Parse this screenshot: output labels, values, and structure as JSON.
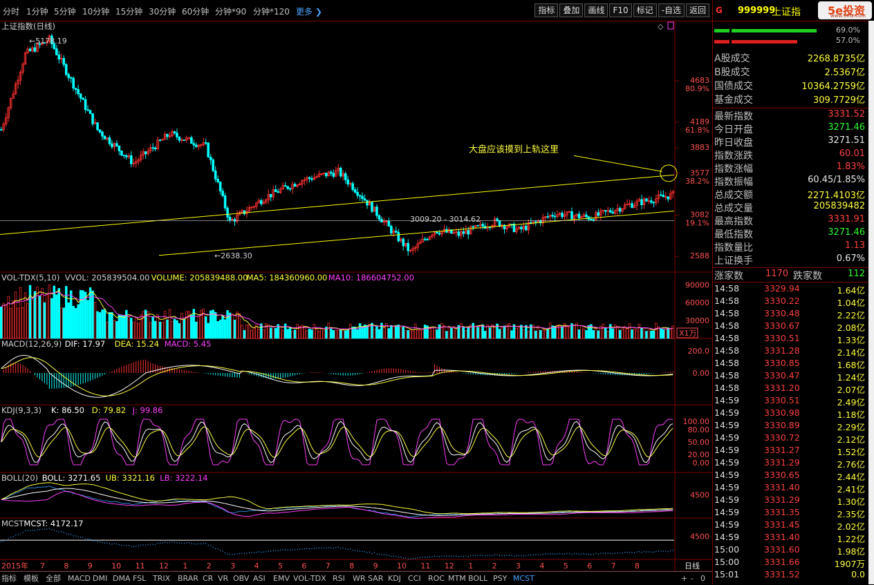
{
  "period_tabs": [
    "分时",
    "1分钟",
    "5分钟",
    "10分钟",
    "15分钟",
    "30分钟",
    "60分钟",
    "分钟*90",
    "分钟*120",
    "更多 ❯"
  ],
  "toolbar_buttons": [
    "指标",
    "叠加",
    "画线",
    "F10",
    "标记",
    "-自选",
    "返回"
  ],
  "main_chart": {
    "title": "上证指数(日线)",
    "high_label": "5178.19",
    "low_label": "2638.30",
    "range_label": "3009.20 - 3014.62",
    "annotation": "大盘应该摸到上轨这里",
    "price_ticks": [
      {
        "value": "4683",
        "pct": "80.9%"
      },
      {
        "value": "4189",
        "pct": "61.8%"
      },
      {
        "value": "3883",
        "pct": ""
      },
      {
        "value": "3577",
        "pct": "38.2%"
      },
      {
        "value": "3082",
        "pct": "19.1%"
      },
      {
        "value": "2588",
        "pct": ""
      }
    ]
  },
  "indicators": {
    "vol": {
      "name": "VOL-TDX(5,10)",
      "vvol": "VVOL: 205839504.00",
      "volume": "VOLUME: 205839488.00",
      "ma5": "MA5: 184360960.00",
      "ma10": "MA10: 186604752.00",
      "ticks": [
        "90000",
        "60000",
        "30000"
      ],
      "unit": "X1万"
    },
    "macd": {
      "name": "MACD(12,26,9)",
      "dif": "DIF: 17.97",
      "dea": "DEA: 15.24",
      "macd": "MACD: 5.45",
      "ticks": [
        "200.0",
        "0.00"
      ]
    },
    "kdj": {
      "name": "KDJ(9,3,3)",
      "k": "K: 86.50",
      "d": "D: 79.82",
      "j": "J: 99.86",
      "ticks": [
        "100.00",
        "80.00",
        "50.00",
        "20.00",
        "0.00"
      ]
    },
    "boll": {
      "name": "BOLL(20)",
      "boll": "BOLL: 3271.65",
      "ub": "UB: 3321.16",
      "lb": "LB: 3222.14",
      "ticks": [
        "4500"
      ]
    },
    "mcst": {
      "name": "MCST",
      "mcst": "MCST: 4172.17",
      "ticks": [
        "4500"
      ]
    }
  },
  "time_axis": {
    "labels": [
      "2015年",
      "7",
      "8",
      "9",
      "10",
      "11",
      "12",
      "1",
      "2",
      "3",
      "4",
      "5",
      "6",
      "7",
      "8",
      "9",
      "10",
      "11",
      "12",
      "1",
      "2",
      "3",
      "4",
      "5",
      "6",
      "7",
      "8"
    ],
    "right_label": "日线"
  },
  "bottom_tabs": [
    "指标",
    "模板",
    "全部",
    "MACD",
    "DMI",
    "DMA",
    "FSL",
    "TRIX",
    "BRAR",
    "CR",
    "VR",
    "OBV",
    "ASI",
    "EMV",
    "VOL-TDX",
    "RSI",
    "WR",
    "SAR",
    "KDJ",
    "CCI",
    "ROC",
    "MTM",
    "BOLL",
    "PSY",
    "MCST"
  ],
  "bottom_active": "MCST",
  "bottom_controls": [
    "+",
    "-",
    "0"
  ],
  "quote": {
    "flag": "G",
    "code": "999999",
    "name": "上证指",
    "logo_text": "5e投资",
    "logo_url": "www.5etz.com",
    "bar_pct_up": "69.0%",
    "bar_pct_down": "57.0%",
    "turnover": [
      {
        "label": "A股成交",
        "value": "2268.8735亿",
        "color": "#ffff40"
      },
      {
        "label": "B股成交",
        "value": "2.5367亿",
        "color": "#ffff40"
      },
      {
        "label": "国债成交",
        "value": "10364.2759亿",
        "color": "#ffff40"
      },
      {
        "label": "基金成交",
        "value": "309.7729亿",
        "color": "#ffff40"
      }
    ],
    "stats": [
      {
        "label": "最新指数",
        "value": "3331.52",
        "color": "#ff4040"
      },
      {
        "label": "今日开盘",
        "value": "3271.46",
        "color": "#30ff30"
      },
      {
        "label": "昨日收盘",
        "value": "3271.51",
        "color": "#e8e8e8"
      },
      {
        "label": "指数涨跌",
        "value": "60.01",
        "color": "#ff4040"
      },
      {
        "label": "指数涨幅",
        "value": "1.83%",
        "color": "#ff4040"
      },
      {
        "label": "指数振幅",
        "value": "60.45/1.85%",
        "color": "#e8e8e8"
      },
      {
        "label": "总成交额",
        "value": "2271.4103亿",
        "color": "#ffff40"
      },
      {
        "label": "总成交量",
        "value": "205839482",
        "color": "#ffff40"
      },
      {
        "label": "最高指数",
        "value": "3331.91",
        "color": "#ff4040"
      },
      {
        "label": "最低指数",
        "value": "3271.46",
        "color": "#30ff30"
      },
      {
        "label": "指数量比",
        "value": "1.13",
        "color": "#ff4040"
      },
      {
        "label": "上证换手",
        "value": "0.67%",
        "color": "#e8e8e8"
      }
    ],
    "advance_label": "涨家数",
    "advance_value": "1170",
    "decline_label": "跌家数",
    "decline_value": "112",
    "ticks": [
      {
        "time": "14:58",
        "price": "3329.94",
        "vol": "1.64亿"
      },
      {
        "time": "14:58",
        "price": "3330.22",
        "vol": "1.04亿"
      },
      {
        "time": "14:58",
        "price": "3330.48",
        "vol": "2.22亿"
      },
      {
        "time": "14:58",
        "price": "3330.67",
        "vol": "2.08亿"
      },
      {
        "time": "14:58",
        "price": "3330.51",
        "vol": "1.33亿"
      },
      {
        "time": "14:58",
        "price": "3331.28",
        "vol": "2.14亿"
      },
      {
        "time": "14:58",
        "price": "3330.85",
        "vol": "1.68亿"
      },
      {
        "time": "14:58",
        "price": "3330.47",
        "vol": "1.24亿"
      },
      {
        "time": "14:58",
        "price": "3331.20",
        "vol": "2.07亿"
      },
      {
        "time": "14:59",
        "price": "3330.51",
        "vol": "2.49亿"
      },
      {
        "time": "14:59",
        "price": "3330.98",
        "vol": "1.18亿"
      },
      {
        "time": "14:59",
        "price": "3330.89",
        "vol": "2.29亿"
      },
      {
        "time": "14:59",
        "price": "3330.72",
        "vol": "2.12亿"
      },
      {
        "time": "14:59",
        "price": "3331.27",
        "vol": "1.52亿"
      },
      {
        "time": "14:59",
        "price": "3331.29",
        "vol": "2.76亿"
      },
      {
        "time": "14:59",
        "price": "3330.65",
        "vol": "2.44亿"
      },
      {
        "time": "14:59",
        "price": "3331.40",
        "vol": "2.41亿"
      },
      {
        "time": "14:59",
        "price": "3331.29",
        "vol": "1.30亿"
      },
      {
        "time": "14:59",
        "price": "3331.35",
        "vol": "2.35亿"
      },
      {
        "time": "14:59",
        "price": "3331.45",
        "vol": "2.02亿"
      },
      {
        "time": "14:59",
        "price": "3331.40",
        "vol": "1.22亿"
      },
      {
        "time": "15:00",
        "price": "3331.60",
        "vol": "1.98亿"
      },
      {
        "time": "15:00",
        "price": "3331.66",
        "vol": "1907万"
      },
      {
        "time": "15:01",
        "price": "3331.52",
        "vol": "0.0"
      }
    ]
  },
  "colors": {
    "up": "#ff3030",
    "down": "#00ffff",
    "bg": "#000000",
    "frame": "#800000",
    "channel": "#ffff00"
  }
}
